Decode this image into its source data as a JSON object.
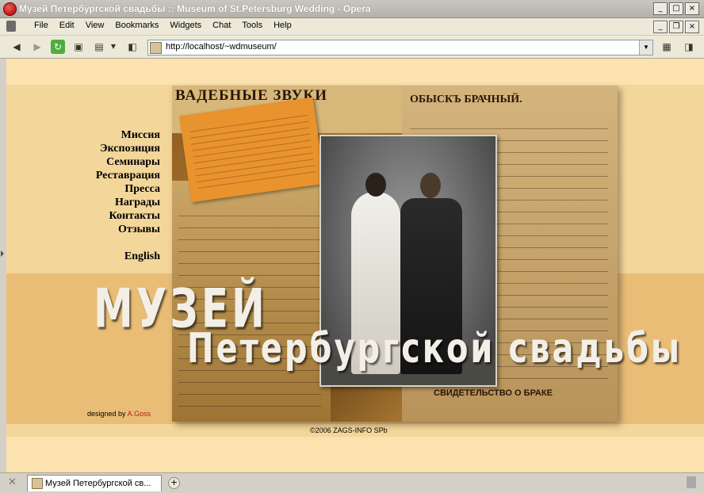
{
  "window": {
    "title": "Музей Петербургской свадьбы :: Museum of St.Petersburg Wedding - Opera",
    "controls": [
      "_",
      "□",
      "×"
    ]
  },
  "menubar": {
    "items": [
      "File",
      "Edit",
      "View",
      "Bookmarks",
      "Widgets",
      "Chat",
      "Tools",
      "Help"
    ],
    "mdi_controls": [
      "_",
      "❐",
      "×"
    ]
  },
  "toolbar": {
    "back_icon": "back-arrow-icon",
    "forward_icon": "forward-arrow-icon",
    "reload_icon": "reload-icon",
    "address": "http://localhost/~wdmuseum/"
  },
  "page": {
    "nav": [
      "Миссия",
      "Экспозиция",
      "Семинары",
      "Реставрация",
      "Пресса",
      "Награды",
      "Контакты",
      "Отзывы"
    ],
    "english": "English",
    "title_line1": "МУЗЕЙ",
    "title_line2": "Петербургской свадьбы",
    "designed_by": "designed by",
    "designer": "A.Goss",
    "copyright": "©2006 ZAGS-INFO SPb",
    "collage_text": {
      "head1": "ВАДЕБНЫЕ ЗВУКИ",
      "head2": "ОБЫСКЪ БРАЧНЫЙ.",
      "head3": "СВИДЕТЕЛЬСТВО О БРАКЕ"
    }
  },
  "tabbar": {
    "tab_label": "Музей Петербургской св...",
    "new_tab": "+"
  }
}
